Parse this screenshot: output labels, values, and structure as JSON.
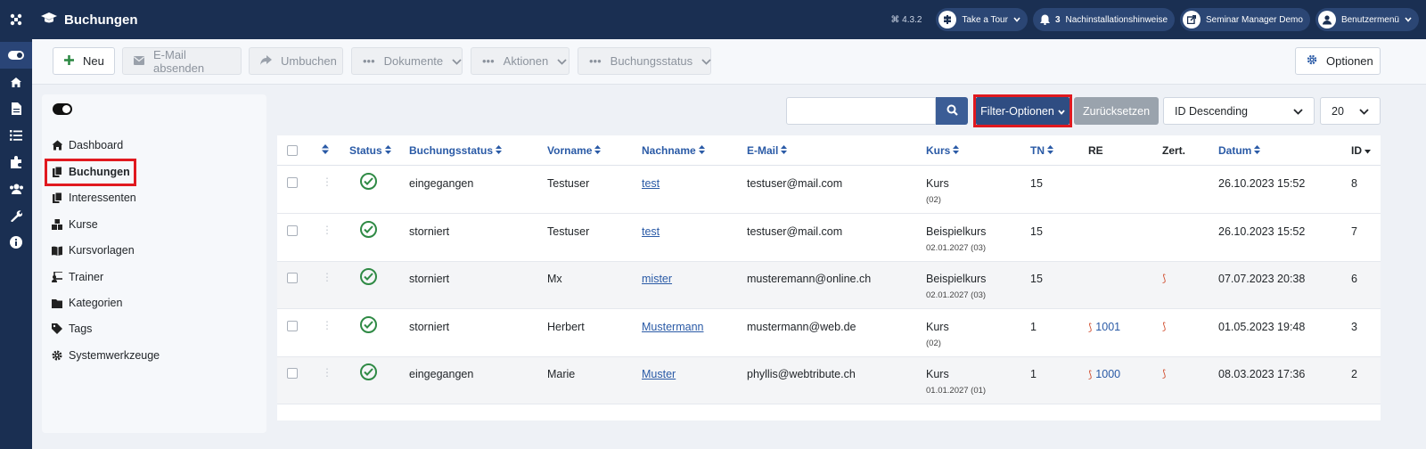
{
  "header": {
    "title": "Buchungen",
    "version": "4.3.2",
    "pills": [
      {
        "label": "Take a Tour",
        "icon": "signpost-icon"
      },
      {
        "label": "Nachinstallationshinweise",
        "count": "3",
        "icon": "bell-icon"
      },
      {
        "label": "Seminar Manager Demo",
        "icon": "external-link-icon"
      },
      {
        "label": "Benutzermenü",
        "icon": "user-icon"
      }
    ]
  },
  "toolbar": {
    "new": "Neu",
    "email": "E-Mail absenden",
    "rebook": "Umbuchen",
    "documents": "Dokumente",
    "actions": "Aktionen",
    "booking_status": "Buchungsstatus",
    "options": "Optionen"
  },
  "sidebar": {
    "items": [
      {
        "label": "Dashboard",
        "icon": "home-icon"
      },
      {
        "label": "Buchungen",
        "icon": "copy-icon"
      },
      {
        "label": "Interessenten",
        "icon": "copy-icon"
      },
      {
        "label": "Kurse",
        "icon": "cubes-icon"
      },
      {
        "label": "Kursvorlagen",
        "icon": "book-icon"
      },
      {
        "label": "Trainer",
        "icon": "chalkboard-teacher-icon"
      },
      {
        "label": "Kategorien",
        "icon": "folder-icon"
      },
      {
        "label": "Tags",
        "icon": "tag-icon"
      },
      {
        "label": "Systemwerkzeuge",
        "icon": "cog-icon"
      }
    ]
  },
  "filters": {
    "search_value": "",
    "filter_options": "Filter-Optionen",
    "reset": "Zurücksetzen",
    "sort": "ID Descending",
    "limit": "20"
  },
  "table": {
    "columns": {
      "status": "Status",
      "booking_status": "Buchungsstatus",
      "first_name": "Vorname",
      "last_name": "Nachname",
      "email": "E-Mail",
      "course": "Kurs",
      "tn": "TN",
      "re": "RE",
      "cert": "Zert.",
      "date": "Datum",
      "id": "ID"
    },
    "rows": [
      {
        "booking_status": "eingegangen",
        "first_name": "Testuser",
        "last_name": "test",
        "email": "testuser@mail.com",
        "course": "Kurs",
        "course_sub": "(02)",
        "tn": "15",
        "re": "",
        "cert": false,
        "date": "26.10.2023 15:52",
        "id": "8"
      },
      {
        "booking_status": "storniert",
        "first_name": "Testuser",
        "last_name": "test",
        "email": "testuser@mail.com",
        "course": "Beispielkurs",
        "course_sub": "02.01.2027 (03)",
        "tn": "15",
        "re": "",
        "cert": false,
        "date": "26.10.2023 15:52",
        "id": "7"
      },
      {
        "booking_status": "storniert",
        "first_name": "Mx",
        "last_name": "mister",
        "email": "musteremann@online.ch",
        "course": "Beispielkurs",
        "course_sub": "02.01.2027 (03)",
        "tn": "15",
        "re": "",
        "cert": true,
        "date": "07.07.2023 20:38",
        "id": "6"
      },
      {
        "booking_status": "storniert",
        "first_name": "Herbert",
        "last_name": "Mustermann",
        "email": "mustermann@web.de",
        "course": "Kurs",
        "course_sub": "(02)",
        "tn": "1",
        "re": "1001",
        "cert": true,
        "date": "01.05.2023 19:48",
        "id": "3"
      },
      {
        "booking_status": "eingegangen",
        "first_name": "Marie",
        "last_name": "Muster",
        "email": "phyllis@webtribute.ch",
        "course": "Kurs",
        "course_sub": "01.01.2027 (01)",
        "tn": "1",
        "re": "1000",
        "cert": true,
        "date": "08.03.2023 17:36",
        "id": "2"
      }
    ]
  }
}
